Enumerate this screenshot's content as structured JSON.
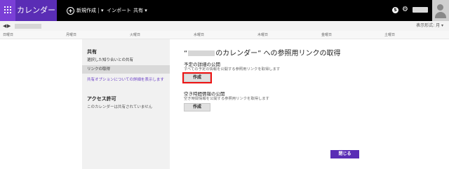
{
  "app": {
    "name": "カレンダー"
  },
  "toolbar": {
    "new_label": "新規作成",
    "import_label": "インポート",
    "share_label": "共有",
    "dropdown_glyph": "▾"
  },
  "nav": {
    "prev_glyph": "◀",
    "next_glyph": "▶",
    "view_mode": "表示形式: 月 ▾"
  },
  "weekdays": [
    "日曜日",
    "月曜日",
    "火曜日",
    "水曜日",
    "木曜日",
    "金曜日",
    "土曜日"
  ],
  "sidebar": {
    "share_header": "共有",
    "items": [
      {
        "label": "選択した知り合いとの共有",
        "selected": false
      },
      {
        "label": "リンクの取得",
        "selected": true
      }
    ],
    "more_link": "共有オプションについての詳細を表示します",
    "access_header": "アクセス許可",
    "access_note": "このカレンダーは共有されていません"
  },
  "dialog": {
    "title_prefix": "“",
    "title_suffix": "のカレンダー” への参照用リンクの取得",
    "details": {
      "heading": "予定の詳細の公開",
      "description": "すべての予定の情報を公開する参照用リンクを取得します",
      "button": "作成"
    },
    "freebusy": {
      "heading": "空き時間情報の公開",
      "description": "空き時間情報を公開する参照用リンクを取得します",
      "button": "作成"
    },
    "close_button": "閉じる"
  },
  "icons": {
    "apps": "waffle-icon",
    "new": "plus-circle-icon",
    "skype": "skype-icon",
    "settings": "gear-icon",
    "profile": "avatar-icon"
  },
  "colors": {
    "brand": "#5a2db5",
    "brand_light": "#7a3fd6",
    "highlight": "#e11111",
    "link": "#6a3fc6"
  }
}
